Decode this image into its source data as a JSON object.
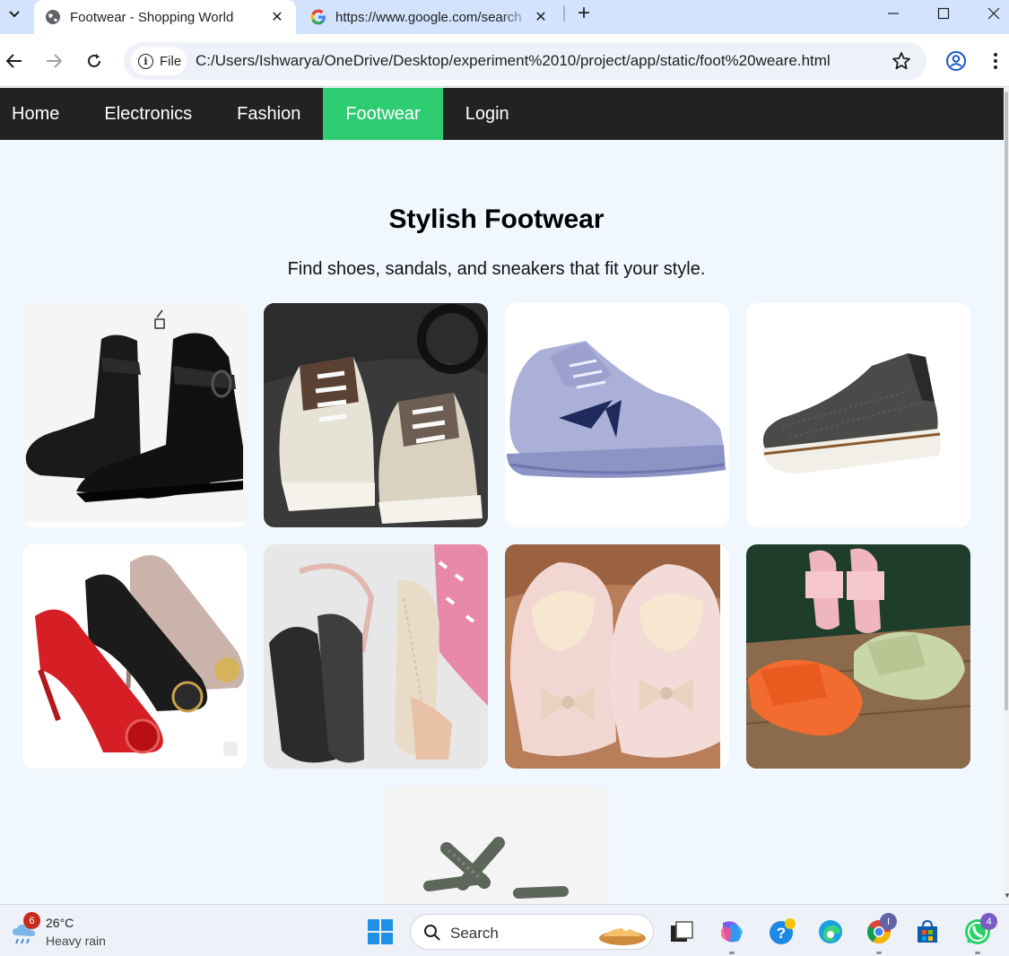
{
  "browser": {
    "tabs": [
      {
        "title": "Footwear - Shopping World",
        "active": true,
        "favicon": "globe-icon"
      },
      {
        "title": "https://www.google.com/search",
        "active": false,
        "favicon": "google-icon"
      }
    ],
    "omnibox": {
      "scheme_chip": "File",
      "url": "C:/Users/Ishwarya/OneDrive/Desktop/experiment%2010/project/app/static/foot%20weare.html"
    }
  },
  "site": {
    "nav": [
      "Home",
      "Electronics",
      "Fashion",
      "Footwear",
      "Login"
    ],
    "active_nav": "Footwear",
    "title": "Stylish Footwear",
    "subtitle": "Find shoes, sandals, and sneakers that fit your style.",
    "products": [
      {
        "icon": "black-ankle-boots-image"
      },
      {
        "icon": "high-top-sneakers-image"
      },
      {
        "icon": "lavender-running-shoe-image"
      },
      {
        "icon": "grey-slip-on-shoe-image"
      },
      {
        "icon": "embellished-heels-image"
      },
      {
        "icon": "shoe-hanger-rack-image"
      },
      {
        "icon": "fluffy-bow-slippers-image"
      },
      {
        "icon": "pool-slides-image"
      },
      {
        "icon": "strappy-sandal-image"
      }
    ]
  },
  "taskbar": {
    "weather": {
      "temp": "26°C",
      "condition": "Heavy rain",
      "badge": "6"
    },
    "search_label": "Search",
    "teams_badge": "I",
    "whatsapp_badge": "4"
  },
  "colors": {
    "nav_bg": "#222222",
    "nav_active": "#2ecc71",
    "page_bg": "#f0f7ff",
    "tabstrip": "#d3e3fd"
  }
}
